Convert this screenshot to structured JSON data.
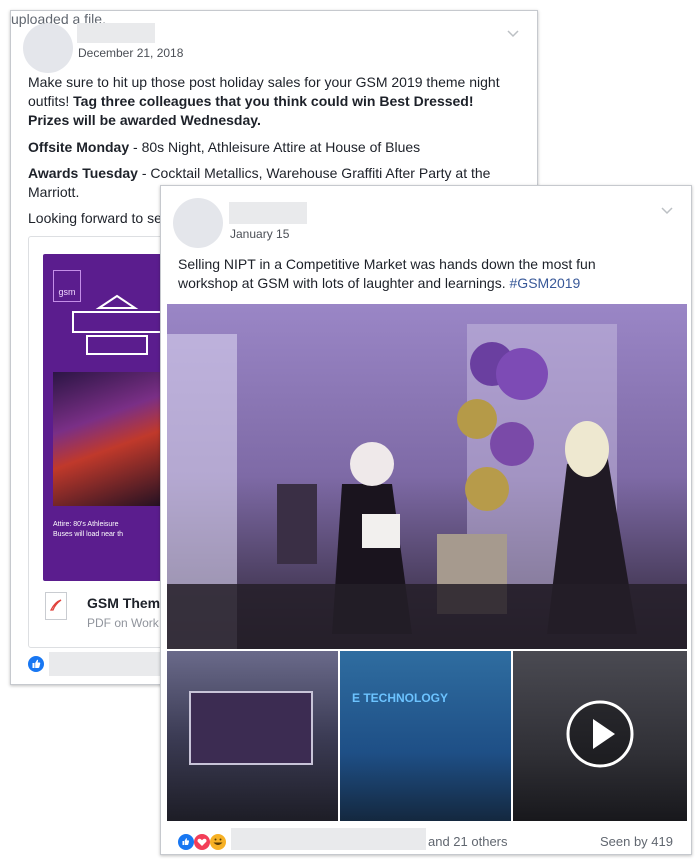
{
  "post1": {
    "action": "uploaded a file.",
    "date": "December 21, 2018",
    "body_line1": "Make sure to hit up those post holiday sales for your GSM 2019 theme night",
    "body_line2_normal": "outfits!  ",
    "body_line2_bold": "Tag three colleagues that you think could win Best Dressed!",
    "body_line3": "Prizes will be awarded Wednesday.",
    "offsite_label": "Offsite Monday",
    "offsite_text": " - 80s Night, Athleisure Attire at House of Blues",
    "awards_label": "Awards Tuesday",
    "awards_text": " - Cocktail Metallics, Warehouse Graffiti After Party at the",
    "awards_line2": "Marriott.",
    "looking": "Looking forward to se",
    "flyer": {
      "logo": "gsm",
      "attire": "Attire: 80's Athleisure",
      "buses": "Buses will load near th"
    },
    "attachment_title": "GSM Them",
    "attachment_sub": "PDF on Work"
  },
  "post2": {
    "date": "January 15",
    "body_line1": "Selling NIPT in a Competitive Market was hands down the most fun",
    "body_line2": "workshop at GSM with lots of laughter and learnings. ",
    "hashtag": "#GSM2019",
    "thumb2_title": "E TECHNOLOGY",
    "reactions_others": "and 21 others",
    "seen_by": "Seen by 419"
  },
  "colors": {
    "like_blue": "#1877f2",
    "love_red": "#f33e58",
    "haha_yellow": "#f7b125",
    "flyer_purple": "#5b1d8e",
    "hashtag": "#385898"
  },
  "icons": [
    "chevron-down-icon",
    "pdf-icon",
    "like-reaction-icon",
    "love-reaction-icon",
    "haha-reaction-icon",
    "play-icon"
  ]
}
